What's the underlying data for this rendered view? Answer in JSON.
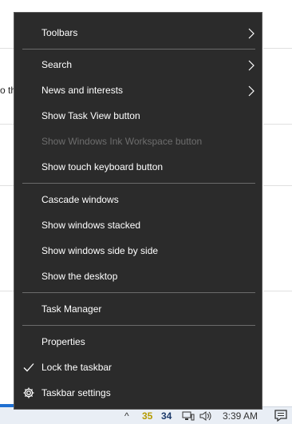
{
  "menu": {
    "toolbars": "Toolbars",
    "search": "Search",
    "news_and_interests": "News and interests",
    "show_task_view": "Show Task View button",
    "show_ink_workspace": "Show Windows Ink Workspace button",
    "show_touch_keyboard": "Show touch keyboard button",
    "cascade_windows": "Cascade windows",
    "show_windows_stacked": "Show windows stacked",
    "show_windows_side_by_side": "Show windows side by side",
    "show_the_desktop": "Show the desktop",
    "task_manager": "Task Manager",
    "properties": "Properties",
    "lock_taskbar": "Lock the taskbar",
    "lock_taskbar_checked": true,
    "taskbar_settings": "Taskbar settings"
  },
  "background": {
    "partial_text": "o th"
  },
  "taskbar": {
    "tray_chevron": "^",
    "tray_value_1": "35",
    "tray_value_2": "34",
    "time": "3:39 AM"
  },
  "colors": {
    "menu_bg": "#2b2b2b",
    "menu_text": "#ffffff",
    "disabled_text": "#6d6d6d",
    "separator": "#6b6b6b",
    "taskbar_bg": "#e9eef5"
  },
  "icons": {
    "submenu_arrow": "chevron-right-icon",
    "checkmark": "checkmark-icon",
    "settings": "gear-icon"
  }
}
